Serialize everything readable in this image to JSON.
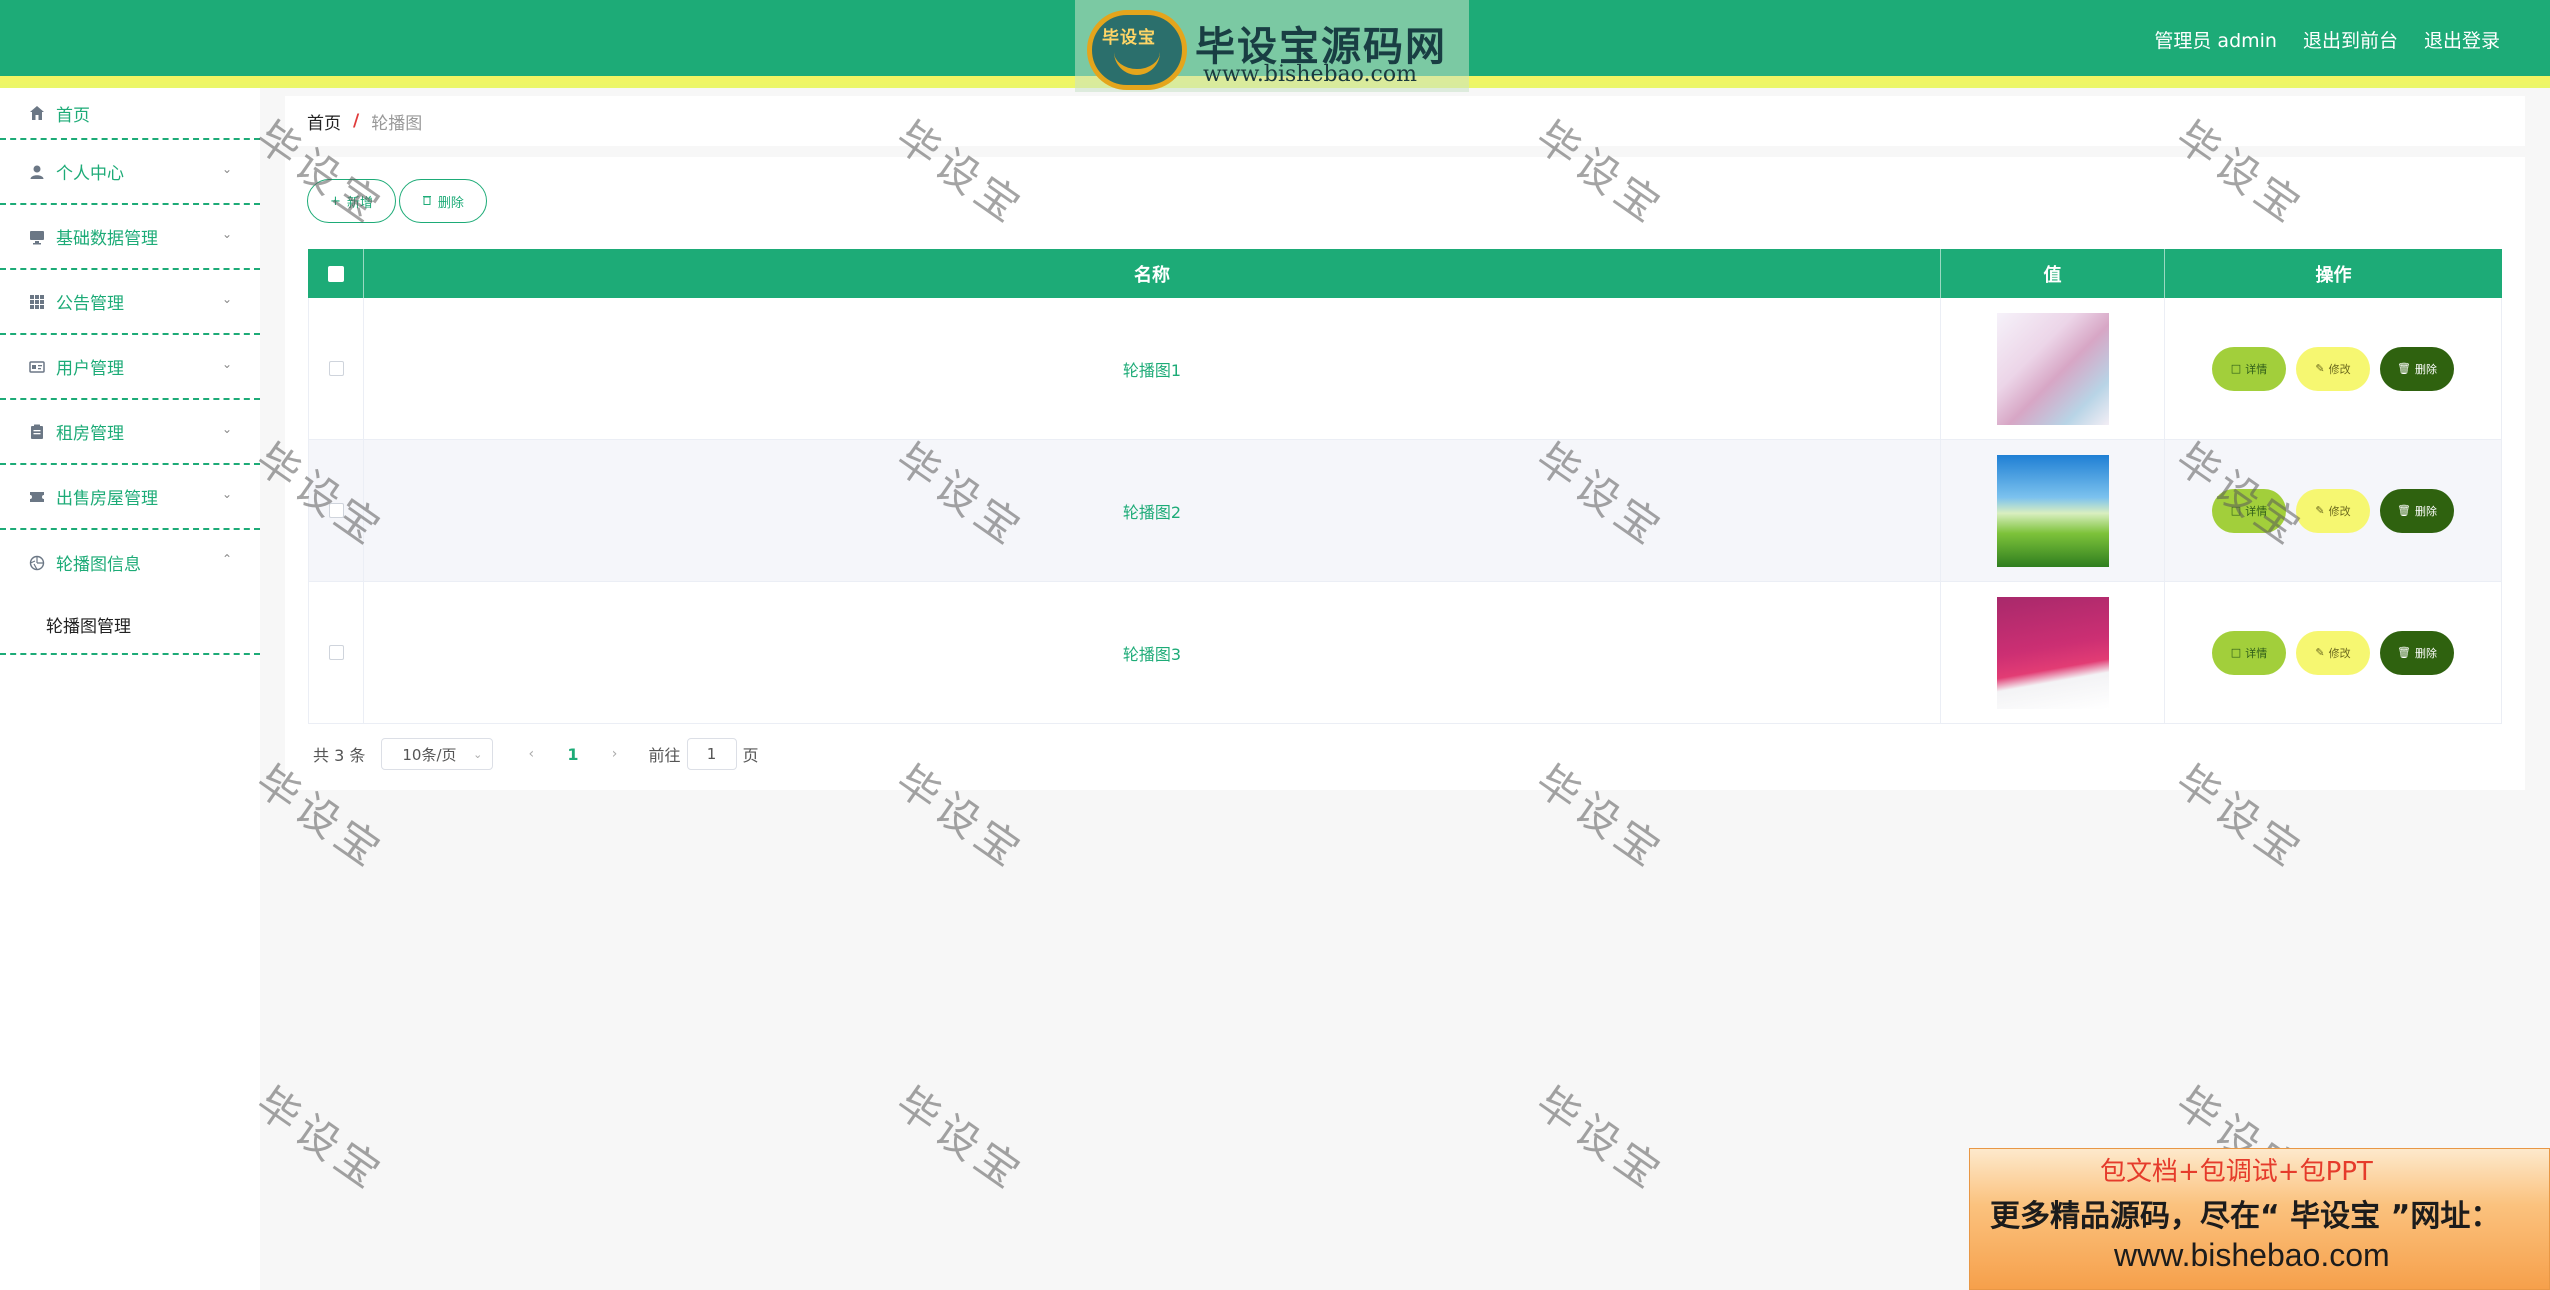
{
  "header": {
    "logo_badge": "毕设宝",
    "logo_title": "毕设宝源码网",
    "logo_url": "www.bishebao.com",
    "admin_label": "管理员 admin",
    "back_front": "退出到前台",
    "logout": "退出登录",
    "color_primary": "#1dab77",
    "color_stripe": "#f4f462"
  },
  "sidebar": {
    "items": [
      {
        "label": "首页",
        "icon": "home-icon"
      },
      {
        "label": "个人中心",
        "icon": "user-icon"
      },
      {
        "label": "基础数据管理",
        "icon": "monitor-icon"
      },
      {
        "label": "公告管理",
        "icon": "grid-icon"
      },
      {
        "label": "用户管理",
        "icon": "id-card-icon"
      },
      {
        "label": "租房管理",
        "icon": "clipboard-icon"
      },
      {
        "label": "出售房屋管理",
        "icon": "ticket-icon"
      },
      {
        "label": "轮播图信息",
        "icon": "aperture-icon"
      }
    ],
    "submenu": {
      "label": "轮播图管理"
    }
  },
  "breadcrumb": {
    "home": "首页",
    "separator": "/",
    "current": "轮播图"
  },
  "toolbar": {
    "add_label": "新增",
    "delete_label": "删除"
  },
  "table": {
    "headers": {
      "name": "名称",
      "value": "值",
      "ops": "操作"
    },
    "rows": [
      {
        "name": "轮播图1",
        "thumb": "pink-flower-image"
      },
      {
        "name": "轮播图2",
        "thumb": "green-grass-sky-image"
      },
      {
        "name": "轮播图3",
        "thumb": "magenta-abstract-image"
      }
    ],
    "ops": {
      "detail": "详情",
      "edit": "修改",
      "delete": "删除"
    }
  },
  "pagination": {
    "total": "共 3 条",
    "page_size": "10条/页",
    "current_page": "1",
    "goto_label": "前往",
    "goto_value": "1",
    "page_suffix": "页"
  },
  "watermark": {
    "text": "毕设宝"
  },
  "ad": {
    "line1": "包文档+包调试+包PPT",
    "line2": "更多精品源码，尽在“ 毕设宝 ”网址：",
    "line3": "www.bishebao.com"
  }
}
